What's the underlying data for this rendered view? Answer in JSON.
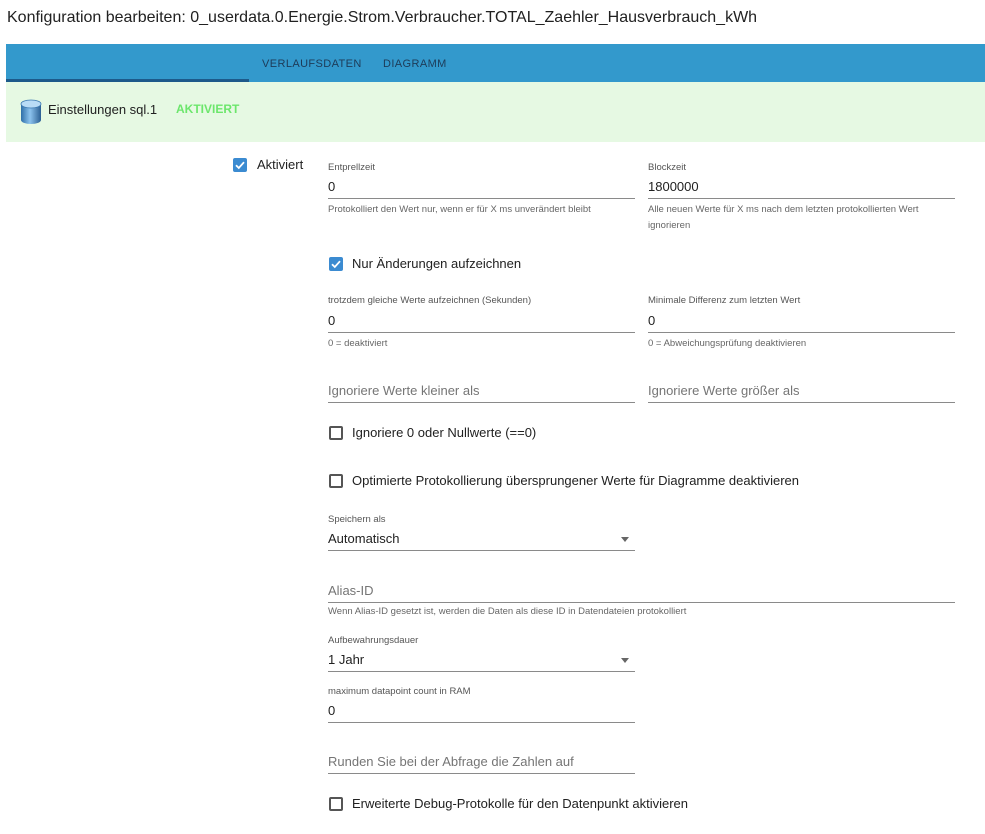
{
  "title": "Konfiguration bearbeiten: 0_userdata.0.Energie.Strom.Verbraucher.TOTAL_Zaehler_Hausverbrauch_kWh",
  "tabs": [
    {
      "label": "VERLAUFSDATEN"
    },
    {
      "label": "DIAGRAMM"
    }
  ],
  "instance": {
    "label": "Einstellungen sql.1",
    "status": "AKTIVIERT",
    "icon": "database-icon"
  },
  "form": {
    "enabled": {
      "label": "Aktiviert",
      "checked": true
    },
    "debounce": {
      "label": "Entprellzeit",
      "value": "0",
      "helper": "Protokolliert den Wert nur, wenn er für X ms unverändert bleibt"
    },
    "blocktime": {
      "label": "Blockzeit",
      "value": "1800000",
      "helper_line1": "Alle neuen Werte für X ms nach dem letzten protokollierten Wert",
      "helper_line2": "ignorieren"
    },
    "changes_only": {
      "label": "Nur Änderungen aufzeichnen",
      "checked": true
    },
    "changes_relog": {
      "label": "trotzdem gleiche Werte aufzeichnen (Sekunden)",
      "value": "0",
      "helper": "0 = deaktiviert"
    },
    "changes_min_delta": {
      "label": "Minimale Differenz zum letzten Wert",
      "value": "0",
      "helper": "0 = Abweichungsprüfung deaktivieren"
    },
    "ignore_below": {
      "placeholder": "Ignoriere Werte kleiner als"
    },
    "ignore_above": {
      "placeholder": "Ignoriere Werte größer als"
    },
    "ignore_zero": {
      "label": "Ignoriere 0 oder Nullwerte (==0)",
      "checked": false
    },
    "disable_skipped": {
      "label": "Optimierte Protokollierung übersprungener Werte für Diagramme deaktivieren",
      "checked": false
    },
    "store_as": {
      "label": "Speichern als",
      "value": "Automatisch"
    },
    "alias_id": {
      "placeholder": "Alias-ID",
      "helper": "Wenn Alias-ID gesetzt ist, werden die Daten als diese ID in Datendateien protokolliert"
    },
    "retention": {
      "label": "Aufbewahrungsdauer",
      "value": "1 Jahr"
    },
    "max_length": {
      "label": "maximum datapoint count in RAM",
      "value": "0"
    },
    "round": {
      "placeholder": "Runden Sie bei der Abfrage die Zahlen auf"
    },
    "debug": {
      "label": "Erweiterte Debug-Protokolle für den Datenpunkt aktivieren",
      "checked": false
    }
  }
}
